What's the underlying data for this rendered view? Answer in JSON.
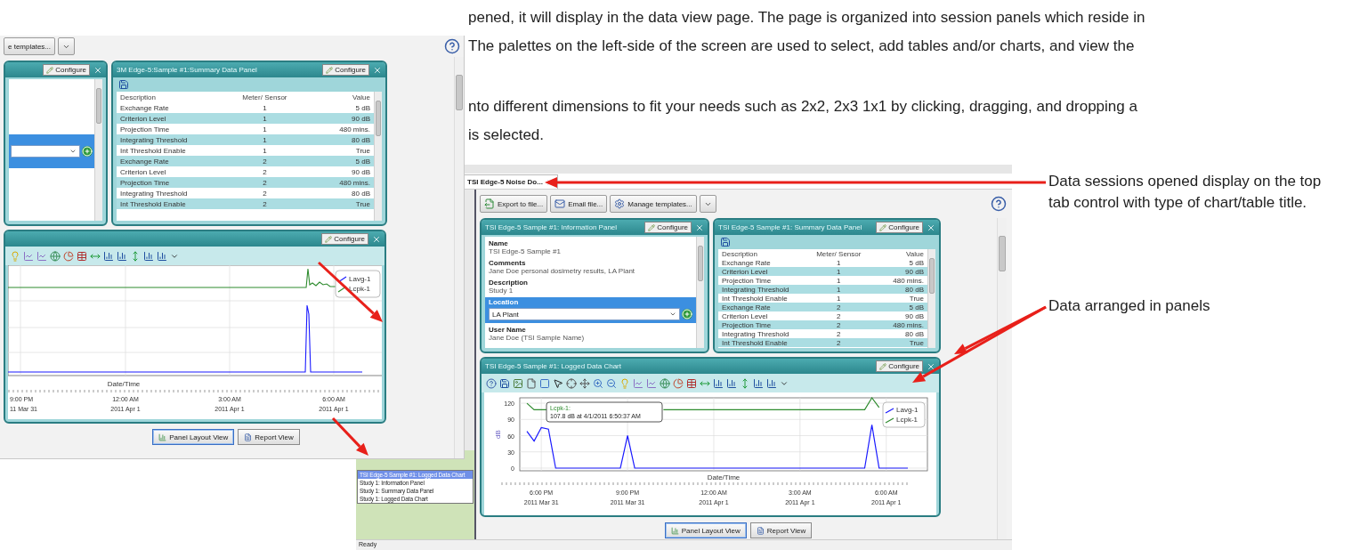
{
  "intro_paragraphs": [
    [
      "pened, it will display in the data view page. The page is organized into session panels which reside in",
      "The palettes on the left-side of the screen are used to select, add tables and/or charts, and view the"
    ],
    [
      "nto different dimensions to fit your needs such as 2x2, 2x3 1x1 by clicking, dragging, and dropping a",
      "is selected."
    ]
  ],
  "back_window": {
    "toolbar": {
      "button": "e templates..."
    },
    "info_panel": {
      "configure": "Configure",
      "location_selected": true
    },
    "summary_panel": {
      "title": "3M Edge-5:Sample #1:Summary Data Panel",
      "configure": "Configure",
      "columns": [
        "Description",
        "Meter/ Sensor",
        "Value"
      ],
      "rows": [
        [
          "Exchange Rate",
          "1",
          "5 dB"
        ],
        [
          "Criterion Level",
          "1",
          "90 dB"
        ],
        [
          "Projection Time",
          "1",
          "480 mins."
        ],
        [
          "Integrating Threshold",
          "1",
          "80 dB"
        ],
        [
          "Int Threshold Enable",
          "1",
          "True"
        ],
        [
          "Exchange Rate",
          "2",
          "5 dB"
        ],
        [
          "Criterion Level",
          "2",
          "90 dB"
        ],
        [
          "Projection Time",
          "2",
          "480 mins."
        ],
        [
          "Integrating Threshold",
          "2",
          "80 dB"
        ],
        [
          "Int Threshold Enable",
          "2",
          "True"
        ]
      ]
    },
    "chart_panel": {
      "configure": "Configure",
      "legend": [
        "Lavg-1",
        "Lcpk-1"
      ],
      "xlabel": "Date/Time",
      "ticks": [
        {
          "time": "9:00 PM",
          "date": "11 Mar 31"
        },
        {
          "time": "12:00 AM",
          "date": "2011 Apr 1"
        },
        {
          "time": "3:00 AM",
          "date": "2011 Apr 1"
        },
        {
          "time": "6:00 AM",
          "date": "2011 Apr 1"
        }
      ]
    },
    "view_buttons": [
      {
        "label": "Panel Layout View",
        "selected": true
      },
      {
        "label": "Report View",
        "selected": false
      }
    ]
  },
  "front_window": {
    "tabs": [
      {
        "label": "TSI Edge-5 Noise Do...",
        "selected": true
      }
    ],
    "toolbar": [
      "Export to file...",
      "Email file...",
      "Manage templates..."
    ],
    "panel_list": [
      {
        "label": "TSI Edge-5 Sample #1: Logged Data Chart",
        "selected": true
      },
      {
        "label": "Study 1: Information Panel",
        "selected": false
      },
      {
        "label": "Study 1: Summary Data Panel",
        "selected": false
      },
      {
        "label": "Study 1: Logged Data Chart",
        "selected": false
      }
    ],
    "info_panel": {
      "title": "TSI Edge-5 Sample #1: Information Panel",
      "configure": "Configure",
      "fields": [
        {
          "kind": "text",
          "label": "Name",
          "value": "TSI Edge-5 Sample #1",
          "selected": false
        },
        {
          "kind": "text",
          "label": "Comments",
          "value": "Jane Doe personal dosimetry results, LA Plant",
          "selected": false
        },
        {
          "kind": "text",
          "label": "Description",
          "value": "Study 1",
          "selected": false
        },
        {
          "kind": "combo",
          "label": "Location",
          "value": "LA Plant",
          "selected": true
        },
        {
          "kind": "text",
          "label": "User Name",
          "value": "Jane Doe (TSI Sample Name)",
          "selected": false
        }
      ]
    },
    "summary_panel": {
      "title": "TSI Edge-5 Sample #1: Summary Data Panel",
      "configure": "Configure",
      "columns": [
        "Description",
        "Meter/ Sensor",
        "Value"
      ],
      "rows": [
        [
          "Exchange Rate",
          "1",
          "5 dB"
        ],
        [
          "Criterion Level",
          "1",
          "90 dB"
        ],
        [
          "Projection Time",
          "1",
          "480 mins."
        ],
        [
          "Integrating Threshold",
          "1",
          "80 dB"
        ],
        [
          "Int Threshold Enable",
          "1",
          "True"
        ],
        [
          "Exchange Rate",
          "2",
          "5 dB"
        ],
        [
          "Criterion Level",
          "2",
          "90 dB"
        ],
        [
          "Projection Time",
          "2",
          "480 mins."
        ],
        [
          "Integrating Threshold",
          "2",
          "80 dB"
        ],
        [
          "Int Threshold Enable",
          "2",
          "True"
        ]
      ]
    },
    "chart_panel": {
      "title": "TSI Edge-5 Sample #1: Logged Data Chart",
      "configure": "Configure",
      "tick_dates": [
        "2011 Mar 31",
        "2011 Mar 31",
        "2011 Apr 1",
        "2011 Apr 1",
        "2011 Apr 1"
      ],
      "chart_data": {
        "type": "line",
        "xlabel": "Date/Time",
        "ylabel": "dB",
        "ylim": [
          -5,
          130
        ],
        "yticks": [
          0,
          30,
          60,
          90,
          120
        ],
        "categories": [
          null,
          null,
          "6:00 PM",
          null,
          null,
          null,
          null,
          null,
          null,
          null,
          null,
          null,
          null,
          null,
          "9:00 PM",
          null,
          null,
          null,
          null,
          null,
          null,
          null,
          null,
          null,
          null,
          null,
          "12:00 AM",
          null,
          null,
          null,
          null,
          null,
          null,
          null,
          null,
          null,
          null,
          null,
          "3:00 AM",
          null,
          null,
          null,
          null,
          null,
          null,
          null,
          null,
          null,
          null,
          null,
          "6:00 AM",
          null,
          null,
          null
        ],
        "series": [
          {
            "name": "Lavg-1",
            "color": "#1a1aff",
            "values": [
              68,
              50,
              75,
              72,
              0,
              0,
              0,
              0,
              0,
              0,
              0,
              0,
              0,
              0,
              60,
              0,
              0,
              0,
              0,
              0,
              0,
              0,
              0,
              0,
              0,
              0,
              0,
              0,
              0,
              0,
              0,
              0,
              0,
              0,
              0,
              0,
              0,
              0,
              0,
              0,
              0,
              0,
              0,
              0,
              0,
              0,
              0,
              0,
              80,
              0,
              0,
              0,
              0,
              0
            ]
          },
          {
            "name": "Lcpk-1",
            "color": "#2e8b2e",
            "values": [
              120,
              108,
              108,
              108,
              108,
              108,
              108,
              null,
              null,
              null,
              null,
              null,
              null,
              null,
              null,
              null,
              null,
              null,
              null,
              108,
              108,
              108,
              108,
              108,
              108,
              108,
              108,
              108,
              108,
              108,
              108,
              108,
              108,
              108,
              108,
              108,
              108,
              108,
              108,
              108,
              108,
              108,
              108,
              108,
              108,
              108,
              108,
              108,
              130,
              112,
              null,
              null,
              null,
              null
            ]
          }
        ],
        "grid": true,
        "legend": "upper right",
        "annotations": [
          {
            "text": "Lcpk-1:"
          },
          {
            "text": "107.8 dB at 4/1/2011 6:50:37 AM"
          }
        ]
      }
    },
    "view_buttons": [
      {
        "label": "Panel Layout View",
        "selected": true
      },
      {
        "label": "Report View",
        "selected": false
      }
    ],
    "status_bar": "Ready"
  },
  "callouts": [
    "Data sessions opened display on the top tab control with type of chart/table title.",
    "Data arranged in panels"
  ]
}
